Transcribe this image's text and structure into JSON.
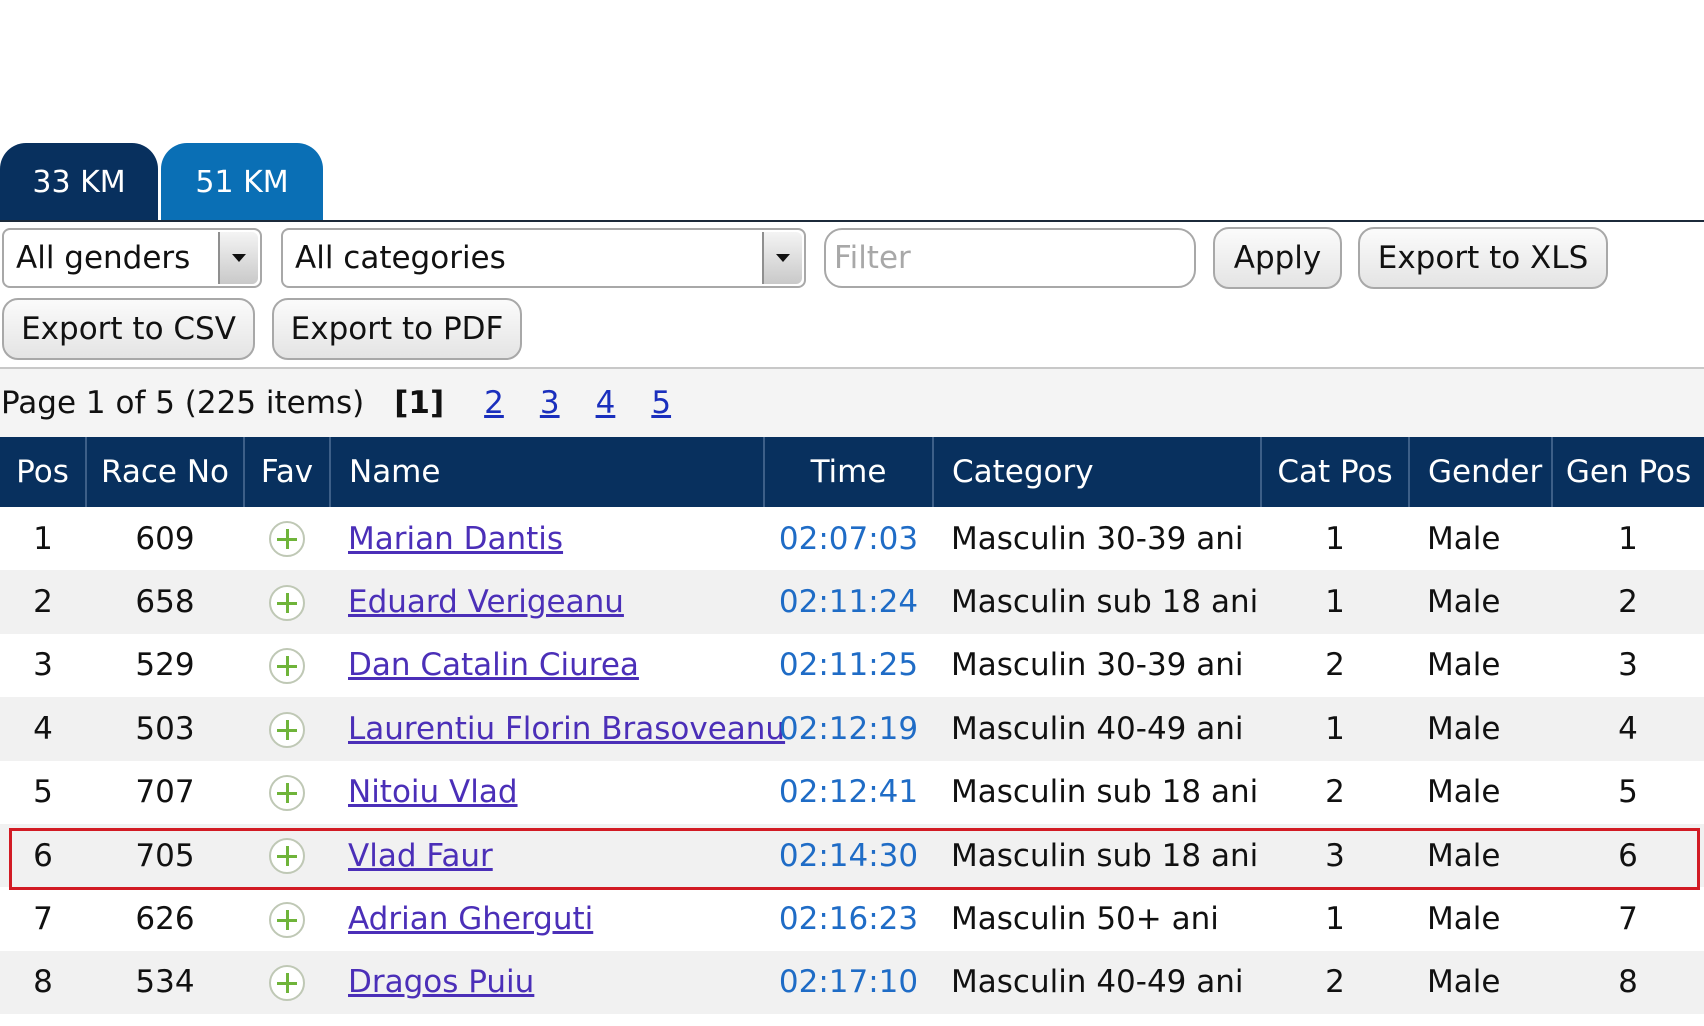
{
  "tabs": [
    {
      "label": "33 KM"
    },
    {
      "label": "51 KM"
    }
  ],
  "toolbar": {
    "gender_select": "All genders",
    "category_select": "All categories",
    "filter_placeholder": "Filter",
    "apply_label": "Apply",
    "export_xls_label": "Export to XLS",
    "export_csv_label": "Export to CSV",
    "export_pdf_label": "Export to PDF"
  },
  "pager": {
    "info": "Page 1 of 5 (225 items)",
    "current": "[1]",
    "pages": [
      "2",
      "3",
      "4",
      "5"
    ]
  },
  "table": {
    "headers": [
      "Pos",
      "Race No",
      "Fav",
      "Name",
      "Time",
      "Category",
      "Cat Pos",
      "Gender",
      "Gen Pos"
    ],
    "rows": [
      [
        "1",
        "609",
        "Marian Dantis",
        "02:07:03",
        "Masculin 30-39 ani",
        "1",
        "Male",
        "1"
      ],
      [
        "2",
        "658",
        "Eduard Verigeanu",
        "02:11:24",
        "Masculin sub 18 ani",
        "1",
        "Male",
        "2"
      ],
      [
        "3",
        "529",
        "Dan Catalin Ciurea",
        "02:11:25",
        "Masculin 30-39 ani",
        "2",
        "Male",
        "3"
      ],
      [
        "4",
        "503",
        "Laurentiu Florin Brasoveanu",
        "02:12:19",
        "Masculin 40-49 ani",
        "1",
        "Male",
        "4"
      ],
      [
        "5",
        "707",
        "Nitoiu Vlad",
        "02:12:41",
        "Masculin sub 18 ani",
        "2",
        "Male",
        "5"
      ],
      [
        "6",
        "705",
        "Vlad Faur",
        "02:14:30",
        "Masculin sub 18 ani",
        "3",
        "Male",
        "6"
      ],
      [
        "7",
        "626",
        "Adrian Gherguti",
        "02:16:23",
        "Masculin 50+ ani",
        "1",
        "Male",
        "7"
      ],
      [
        "8",
        "534",
        "Dragos Puiu",
        "02:17:10",
        "Masculin 40-49 ani",
        "2",
        "Male",
        "8"
      ]
    ]
  },
  "colors": {
    "header_bg": "#08305e",
    "tab_active": "#0a6fb5",
    "link": "#4b2fb8",
    "time": "#1f6cc6",
    "highlight": "#d21b24"
  }
}
